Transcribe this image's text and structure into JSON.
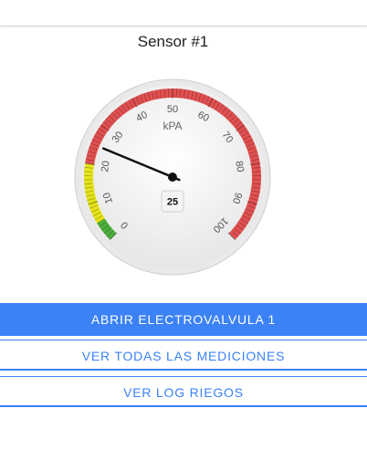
{
  "sensor": {
    "title": "Sensor #1",
    "unit": "kPA",
    "value": 25,
    "value_label": "25",
    "min": 0,
    "max": 100,
    "tick_labels": [
      "0",
      "10",
      "20",
      "30",
      "40",
      "50",
      "60",
      "70",
      "80",
      "90",
      "100"
    ],
    "zones": [
      {
        "from": 0,
        "to": 5,
        "color": "#4caf3c"
      },
      {
        "from": 5,
        "to": 20,
        "color": "#e6e31a"
      },
      {
        "from": 20,
        "to": 100,
        "color": "#e05050"
      }
    ]
  },
  "actions": {
    "open_valve": "ABRIR ELECTROVALVULA 1",
    "view_all": "VER TODAS LAS MEDICIONES",
    "view_log": "VER LOG RIEGOS"
  },
  "colors": {
    "primary": "#3b82f6",
    "needle": "#111111"
  }
}
